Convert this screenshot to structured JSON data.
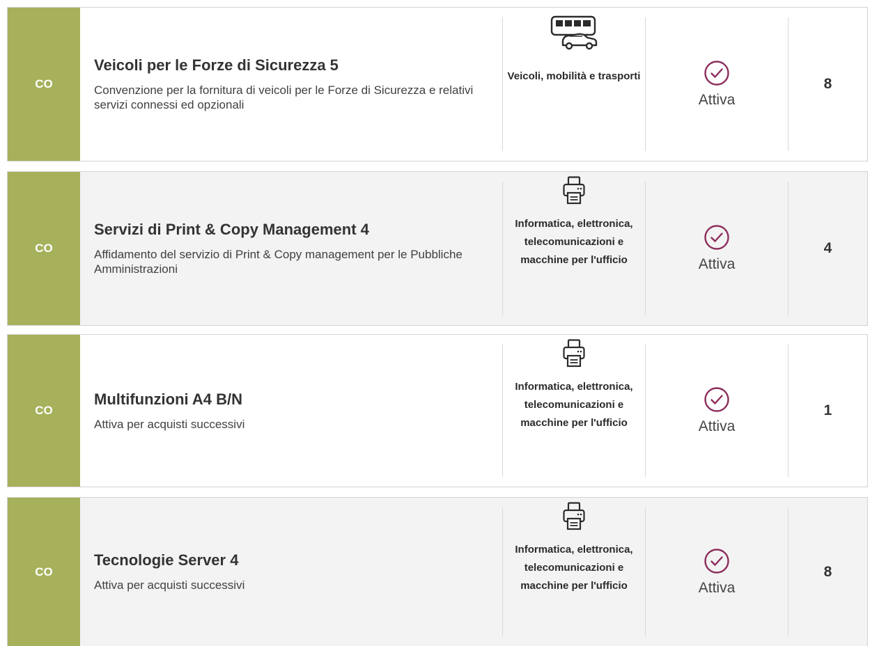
{
  "rows": [
    {
      "tag": "CO",
      "title": "Veicoli per le Forze di Sicurezza 5",
      "description": "Convenzione per la fornitura di veicoli per le Forze di Sicurezza e relativi servizi connessi ed opzionali",
      "category_icon": "bus-car-icon",
      "category": "Veicoli, mobilità e trasporti",
      "status_icon": "check-circle-icon",
      "status": "Attiva",
      "count": "8"
    },
    {
      "tag": "CO",
      "title": "Servizi di Print & Copy Management 4",
      "description": "Affidamento del servizio di Print & Copy management per le Pubbliche Amministrazioni",
      "category_icon": "printer-icon",
      "category": "Informatica, elettronica, telecomunicazioni e macchine per l'ufficio",
      "status_icon": "check-circle-icon",
      "status": "Attiva",
      "count": "4"
    },
    {
      "tag": "CO",
      "title": "Multifunzioni A4 B/N",
      "description": "Attiva per acquisti successivi",
      "category_icon": "printer-icon",
      "category": "Informatica, elettronica, telecomunicazioni e macchine per l'ufficio",
      "status_icon": "check-circle-icon",
      "status": "Attiva",
      "count": "1"
    },
    {
      "tag": "CO",
      "title": "Tecnologie Server 4",
      "description": "Attiva per acquisti successivi",
      "category_icon": "printer-icon",
      "category": "Informatica, elettronica, telecomunicazioni e macchine per l'ufficio",
      "status_icon": "check-circle-icon",
      "status": "Attiva",
      "count": "8"
    }
  ],
  "colors": {
    "tag_background": "#a7b05b",
    "status_icon": "#8b2c5a",
    "alt_row_background": "#f3f3f3"
  }
}
